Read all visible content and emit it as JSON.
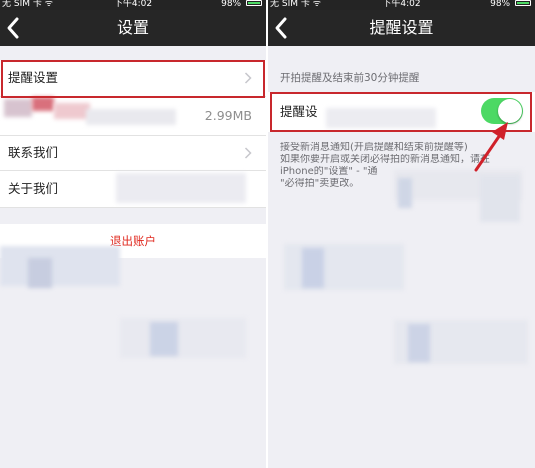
{
  "status_bar": {
    "carrier": "无 SIM 卡 ᯤ",
    "time": "下午4:02",
    "battery": "98%",
    "battery_level": 0.98
  },
  "left_screen": {
    "title": "设置",
    "rows": [
      {
        "label": "提醒设置",
        "value": ""
      },
      {
        "label": "",
        "value": "2.99MB"
      },
      {
        "label": "联系我们",
        "value": ""
      },
      {
        "label": "关于我们",
        "value": ""
      }
    ],
    "logout_label": "退出账户"
  },
  "right_screen": {
    "title": "提醒设置",
    "section_caption": "开拍提醒及结束前30分钟提醒",
    "reminder_label": "提醒设",
    "toggle_on": true,
    "footnote_lines": [
      "接受新消息通知(开启提醒和结束前提醒等)",
      "如果你要开启或关闭必得拍的新消息通知，请在",
      "iPhone的\"设置\" - \"通",
      "\"必得拍\"卖更改。"
    ]
  },
  "colors": {
    "nav_background": "#262626",
    "page_background": "#efeff4",
    "highlight_border": "#c8282d",
    "logout_text": "#e0281e",
    "toggle_on": "#4cd964"
  },
  "icons": {
    "back": "chevron-left-icon",
    "disclosure": "chevron-right-icon",
    "battery": "battery-icon",
    "annotation": "red-arrow-icon"
  }
}
